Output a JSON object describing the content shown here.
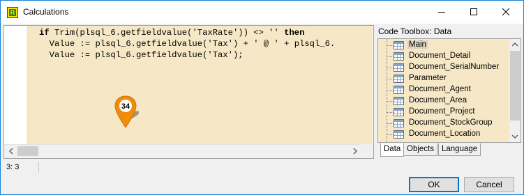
{
  "window": {
    "title": "Calculations",
    "app_icon_letter": "R"
  },
  "editor": {
    "lines": [
      {
        "indent": "",
        "parts": [
          {
            "t": "if",
            "cls": "kw"
          },
          {
            "t": " Trim(plsql_6.getfieldvalue(",
            "cls": ""
          },
          {
            "t": "'TaxRate'",
            "cls": ""
          },
          {
            "t": ")) <> ",
            "cls": ""
          },
          {
            "t": "''",
            "cls": ""
          },
          {
            "t": " ",
            "cls": ""
          },
          {
            "t": "then",
            "cls": "kw"
          }
        ]
      },
      {
        "indent": "  ",
        "parts": [
          {
            "t": "Value := plsql_6.getfieldvalue(",
            "cls": ""
          },
          {
            "t": "'Tax'",
            "cls": ""
          },
          {
            "t": ") + ",
            "cls": ""
          },
          {
            "t": "' @ '",
            "cls": ""
          },
          {
            "t": " + plsql_6.",
            "cls": ""
          }
        ]
      },
      {
        "indent": "  ",
        "parts": [
          {
            "t": "Value := plsql_6.getfieldvalue(",
            "cls": ""
          },
          {
            "t": "'Tax'",
            "cls": ""
          },
          {
            "t": ");",
            "cls": ""
          }
        ]
      }
    ],
    "marker_number": "34"
  },
  "toolbox": {
    "title": "Code Toolbox: Data",
    "items": [
      {
        "label": "Main",
        "selected": true
      },
      {
        "label": "Document_Detail",
        "selected": false
      },
      {
        "label": "Document_SerialNumber",
        "selected": false
      },
      {
        "label": "Parameter",
        "selected": false
      },
      {
        "label": "Document_Agent",
        "selected": false
      },
      {
        "label": "Document_Area",
        "selected": false
      },
      {
        "label": "Document_Project",
        "selected": false
      },
      {
        "label": "Document_StockGroup",
        "selected": false
      },
      {
        "label": "Document_Location",
        "selected": false
      }
    ],
    "tabs": [
      {
        "label": "Data",
        "active": true
      },
      {
        "label": "Objects",
        "active": false
      },
      {
        "label": "Language",
        "active": false
      }
    ]
  },
  "status": {
    "cursor": "3: 3"
  },
  "buttons": {
    "ok": "OK",
    "cancel": "Cancel"
  }
}
